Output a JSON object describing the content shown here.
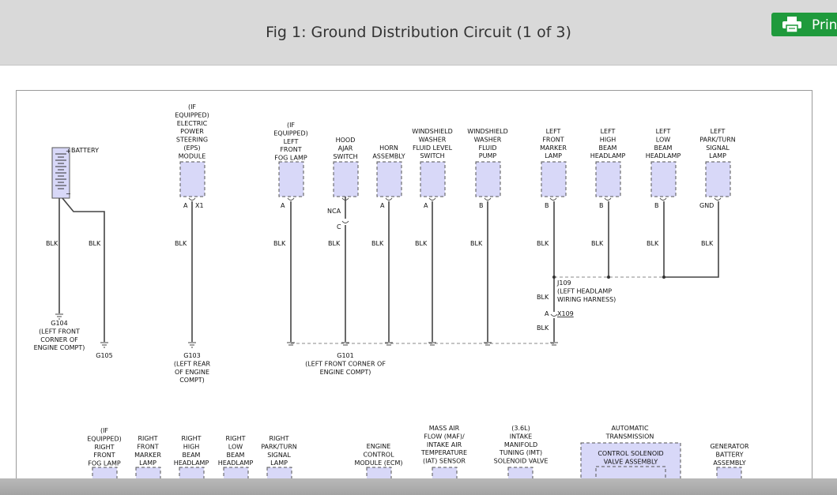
{
  "header": {
    "title": "Fig 1: Ground Distribution Circuit (1 of 3)",
    "print_label": "Print"
  },
  "labels": {
    "battery": "BATTERY",
    "eps": [
      "(IF",
      "EQUIPPED)",
      "ELECTRIC",
      "POWER",
      "STEERING",
      "(EPS)",
      "MODULE"
    ],
    "lfog": [
      "(IF",
      "EQUIPPED)",
      "LEFT",
      "FRONT",
      "FOG LAMP"
    ],
    "hood": [
      "HOOD",
      "AJAR",
      "SWITCH"
    ],
    "horn": [
      "HORN",
      "ASSEMBLY"
    ],
    "wwfls": [
      "WINDSHIELD",
      "WASHER",
      "FLUID LEVEL",
      "SWITCH"
    ],
    "wwfp": [
      "WINDSHIELD",
      "WASHER",
      "FLUID",
      "PUMP"
    ],
    "lfml": [
      "LEFT",
      "FRONT",
      "MARKER",
      "LAMP"
    ],
    "lhbh": [
      "LEFT",
      "HIGH",
      "BEAM",
      "HEADLAMP"
    ],
    "llbh": [
      "LEFT",
      "LOW",
      "BEAM",
      "HEADLAMP"
    ],
    "lpts": [
      "LEFT",
      "PARK/TURN",
      "SIGNAL",
      "LAMP"
    ],
    "rfog": [
      "(IF",
      "EQUIPPED)",
      "RIGHT",
      "FRONT",
      "FOG LAMP"
    ],
    "rfml": [
      "RIGHT",
      "FRONT",
      "MARKER",
      "LAMP"
    ],
    "rhbh": [
      "RIGHT",
      "HIGH",
      "BEAM",
      "HEADLAMP"
    ],
    "rlbh": [
      "RIGHT",
      "LOW",
      "BEAM",
      "HEADLAMP"
    ],
    "rpts": [
      "RIGHT",
      "PARK/TURN",
      "SIGNAL",
      "LAMP"
    ],
    "ecm": [
      "ENGINE",
      "CONTROL",
      "MODULE (ECM)"
    ],
    "maf": [
      "MASS AIR",
      "FLOW (MAF)/",
      "INTAKE AIR",
      "TEMPERATURE",
      "(IAT) SENSOR"
    ],
    "imt": [
      "(3.6L)",
      "INTAKE",
      "MANIFOLD",
      "TUNING (IMT)",
      "SOLENOID VALVE"
    ],
    "atrans": [
      "AUTOMATIC",
      "TRANSMISSION"
    ],
    "csva": [
      "CONTROL SOLENOID",
      "VALVE ASSEMBLY"
    ],
    "gba": [
      "GENERATOR",
      "BATTERY",
      "ASSEMBLY"
    ],
    "g104": [
      "G104",
      "(LEFT FRONT",
      "CORNER OF",
      "ENGINE COMPT)"
    ],
    "g105": "G105",
    "g103": [
      "G103",
      "(LEFT REAR",
      "OF ENGINE",
      "COMPT)"
    ],
    "g101": [
      "G101",
      "(LEFT FRONT CORNER OF",
      "ENGINE COMPT)"
    ],
    "j109": [
      "J109",
      "(LEFT HEADLAMP",
      "WIRING HARNESS)"
    ],
    "x109": "X109",
    "x1": "X1",
    "nca": "NCA",
    "pin_a": "A",
    "pin_b": "B",
    "pin_c": "C",
    "gnd": "GND",
    "blk": "BLK"
  }
}
